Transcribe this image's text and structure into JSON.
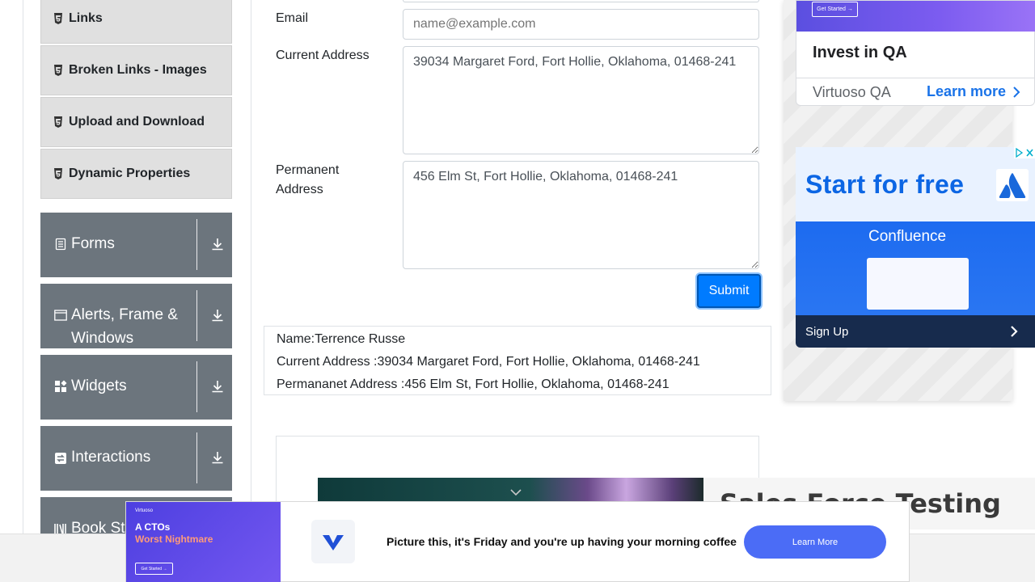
{
  "sidebar": {
    "sub_items": [
      {
        "label": "Links"
      },
      {
        "label": "Broken Links - Images"
      },
      {
        "label": "Upload and Download"
      },
      {
        "label": "Dynamic Properties"
      }
    ],
    "groups": [
      {
        "label": "Forms",
        "icon": "form-icon"
      },
      {
        "label_line1": "Alerts, Frame &",
        "label_line2": "Windows",
        "icon": "window-icon"
      },
      {
        "label": "Widgets",
        "icon": "widgets-icon"
      },
      {
        "label": "Interactions",
        "icon": "interactions-icon"
      },
      {
        "label": "Book Store Application",
        "icon": "book-icon"
      }
    ]
  },
  "form": {
    "email_label": "Email",
    "email_placeholder": "name@example.com",
    "email_value": "",
    "current_address_label": "Current Address",
    "current_address_value": "39034 Margaret Ford, Fort Hollie, Oklahoma, 01468-241",
    "permanent_address_label_line1": "Permanent",
    "permanent_address_label_line2": "Address",
    "permanent_address_value": "456 Elm St, Fort Hollie, Oklahoma, 01468-241",
    "submit_label": "Submit"
  },
  "output": {
    "name": "Name:Terrence Russe",
    "current_address": "Current Address :39034 Margaret Ford, Fort Hollie, Oklahoma, 01468-241",
    "permanent_address": "Permananet Address :456 Elm St, Fort Hollie, Oklahoma, 01468-241"
  },
  "ads": {
    "invest": {
      "get_started": "Get Started →",
      "title": "Invest in QA",
      "brand": "Virtuoso QA",
      "cta": "Learn more"
    },
    "atlassian": {
      "headline": "Start for free",
      "product": "Confluence",
      "cta": "Sign Up"
    },
    "salesforce": {
      "title": "Sales Force Testing"
    },
    "bottom": {
      "brand": "Virtuoso",
      "headline_prefix": "A CTOs",
      "headline_highlight": "Worst Nightmare",
      "get_started": "Get Started →",
      "text": "Picture this, it's Friday and you're up having your morning coffee",
      "cta": "Learn More"
    }
  },
  "colors": {
    "primary": "#007bff",
    "sidebar_group": "#6c757d",
    "sidebar_item": "#e0e0e0"
  }
}
